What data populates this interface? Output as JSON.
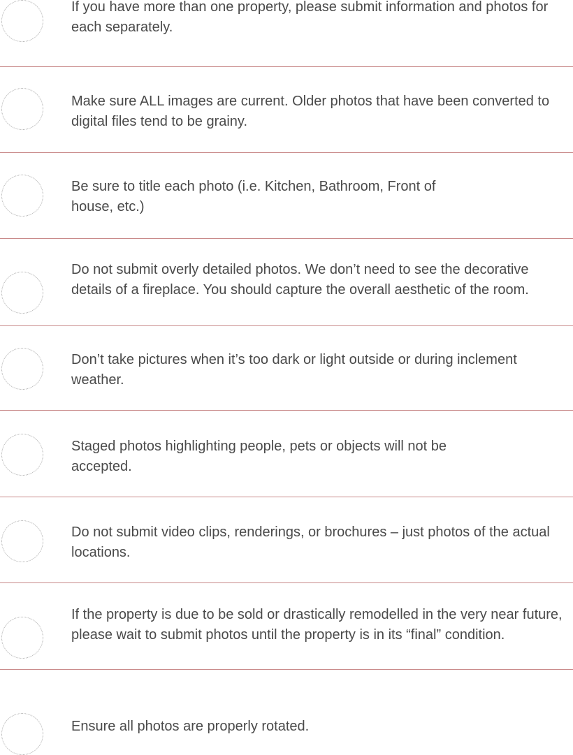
{
  "guidelines": [
    {
      "text": "If you have more than one property, please submit information and photos for each separately."
    },
    {
      "text": "Make sure ALL images are current. Older photos that have been converted to digital files tend to be grainy."
    },
    {
      "text": "Be sure to title each photo (i.e. Kitchen, Bathroom, Front of house, etc.)"
    },
    {
      "text": "Do not submit overly detailed photos. We don’t need to see the decorative details of a fireplace. You should capture the overall aesthetic of the room."
    },
    {
      "text": "Don’t take pictures when it’s too dark or light outside or during inclement weather."
    },
    {
      "text": "Staged photos highlighting people, pets or objects will not be accepted."
    },
    {
      "text": "Do not submit video clips, renderings, or brochures – just photos of the actual locations."
    },
    {
      "text": "If the property is due to be sold or drastically remodelled in the very near future, please wait to submit photos until the property is in its “final” condition."
    },
    {
      "text": "Ensure all photos are properly rotated."
    }
  ],
  "colors": {
    "text": "#4a4a4a",
    "divider": "#c98a8a",
    "circle": "#b0b0b0"
  }
}
